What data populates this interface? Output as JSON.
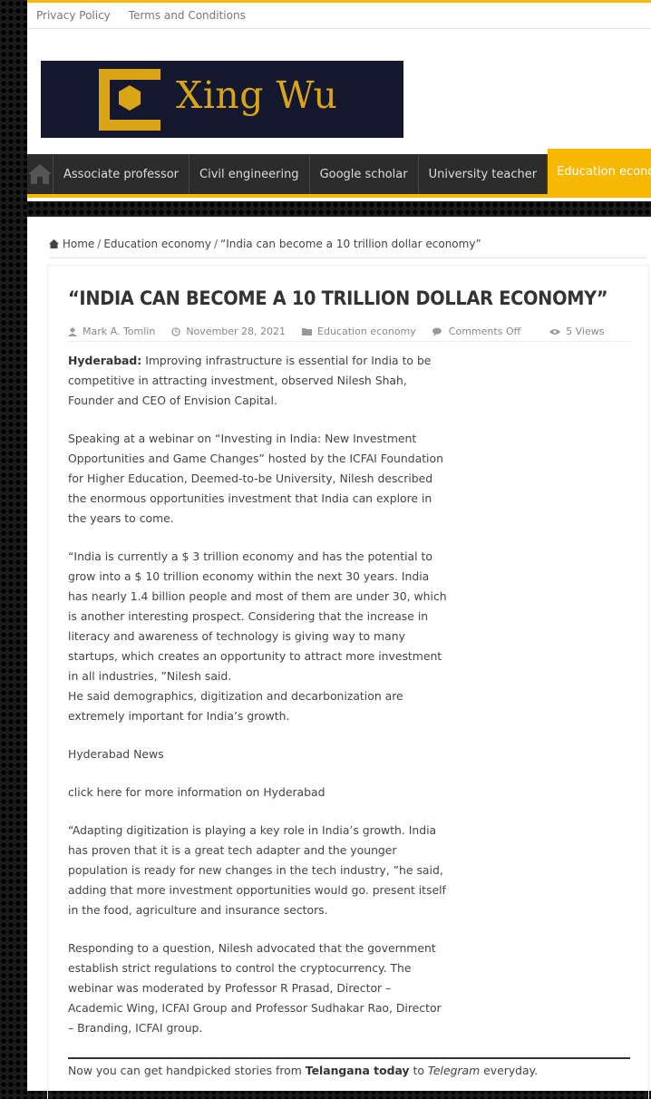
{
  "topbar": {
    "links": [
      "Privacy Policy",
      "Terms and Conditions"
    ]
  },
  "logo": {
    "text": "Xing Wu",
    "accent": "#d9a517",
    "background": "#13182e"
  },
  "nav": {
    "home_icon": "home-icon",
    "items": [
      "Associate professor",
      "Civil engineering",
      "Google scholar",
      "University teacher",
      "Education economy"
    ],
    "active": "Education economy",
    "accent": "#f6b800"
  },
  "breadcrumb": {
    "home": "Home",
    "category": "Education economy",
    "current": "“India can become a 10 trillion dollar economy”"
  },
  "article": {
    "title": "“INDIA CAN BECOME A 10 TRILLION DOLLAR ECONOMY”",
    "meta": {
      "author": "Mark A. Tomlin",
      "date": "November 28, 2021",
      "category": "Education economy",
      "comments": "Comments Off",
      "views": "5 Views"
    },
    "lead_bold": "Hyderabad:",
    "lead_text": " Improving infrastructure is essential for India to be competitive in attracting investment, observed Nilesh Shah, Founder and CEO of Envision Capital.",
    "p2": "Speaking at a webinar on “Investing in India: New Investment Opportunities and Game Changes” hosted by the ICFAI Foundation for Higher Education, Deemed-to-be University, Nilesh described the enormous opportunities investment that India can explore in the years to come.",
    "p3": "“India is currently a $ 3 trillion economy and has the potential to grow into a $ 10 trillion economy within the next 30 years. India has nearly 1.4 billion people and most of them are under 30, which is another interesting prospect. Considering that the increase in literacy and awareness of technology is giving way to many startups, which creates an opportunity to attract more investment in all industries, ”Nilesh said.",
    "p4": "He said demographics, digitization and decarbonization are extremely important for India’s growth.",
    "p5": "Hyderabad News",
    "p6": "click here for more information on Hyderabad",
    "p7": "“Adapting digitization is playing a key role in India’s growth. India has proven that it is a great tech adapter and the younger population is ready for new changes in the tech industry, ”he said, adding that more investment opportunities would go. present itself in the food, agriculture and insurance sectors.",
    "p8": "Responding to a question, Nilesh advocated that the government establish strict regulations to control the cryptocurrency. The webinar was moderated by Professor R Prasad, Director – Academic Wing, ICFAI Group and Professor Sudhakar Rao, Director – Branding, ICFAI group.",
    "footer_pre": "Now you can get handpicked stories from ",
    "footer_bold": "Telangana today",
    "footer_mid": " to ",
    "footer_italic": "Telegram",
    "footer_post": " everyday."
  }
}
